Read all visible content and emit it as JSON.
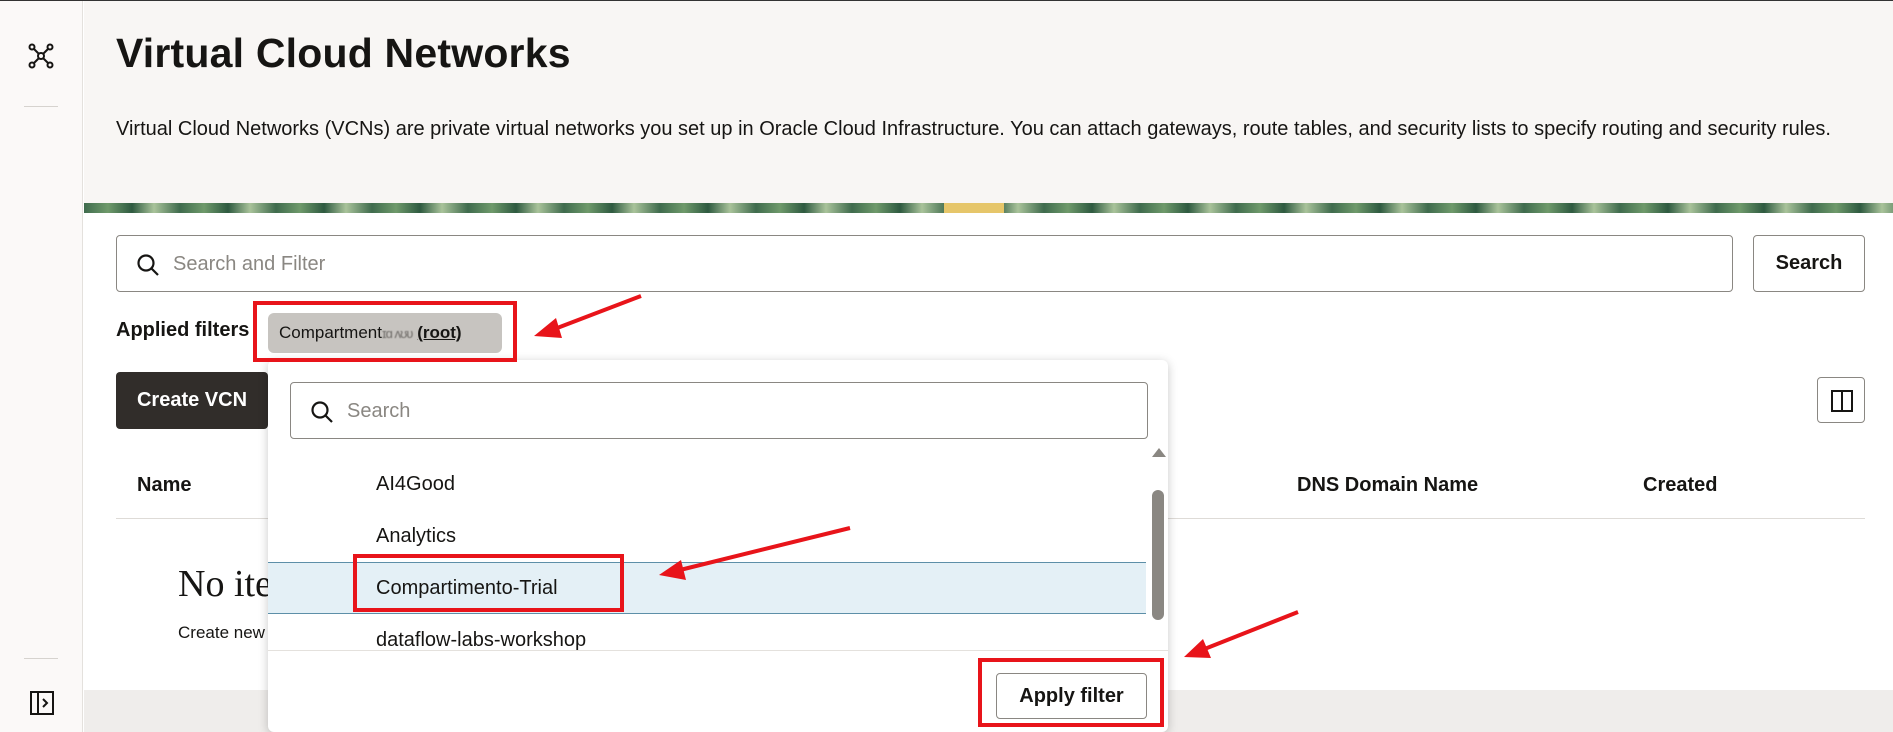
{
  "rail": {
    "top_icon": "network-icon",
    "bottom_icon": "panel-toggle-icon"
  },
  "header": {
    "title": "Virtual Cloud Networks",
    "description": "Virtual Cloud Networks (VCNs) are private virtual networks you set up in Oracle Cloud Infrastructure. You can attach gateways, route tables, and security lists to specify routing and security rules."
  },
  "search": {
    "placeholder": "Search and Filter",
    "button_label": "Search"
  },
  "filters": {
    "label": "Applied filters",
    "chip_prefix": "Compartment",
    "chip_obscured": "ɪɑ ʌʊʋ",
    "chip_value": "(root)"
  },
  "actions": {
    "create_label": "Create VCN",
    "columns_icon": "columns-icon"
  },
  "table": {
    "headers": [
      "Name",
      "DNS Domain Name",
      "Created"
    ]
  },
  "empty_state": {
    "title": "No ite",
    "subtitle": "Create new"
  },
  "dropdown": {
    "search_placeholder": "Search",
    "items": [
      {
        "label": "AI4Good",
        "selected": false
      },
      {
        "label": "Analytics",
        "selected": false
      },
      {
        "label": "Compartimento-Trial",
        "selected": true
      },
      {
        "label": "dataflow-labs-workshop",
        "selected": false
      }
    ],
    "apply_label": "Apply filter"
  },
  "annotations": {
    "color": "#e8141a"
  }
}
